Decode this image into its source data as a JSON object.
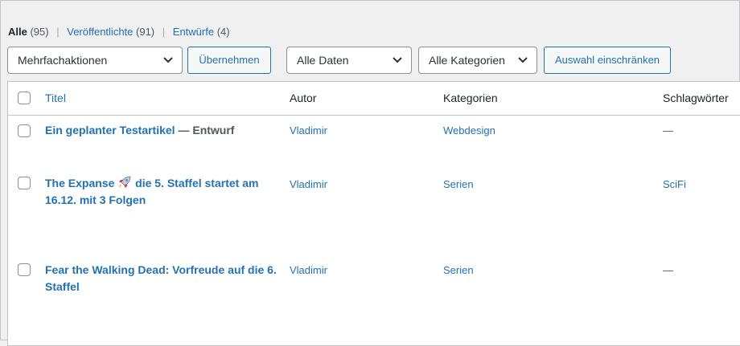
{
  "filters": {
    "all_label": "Alle",
    "all_count": "(95)",
    "published_label": "Veröffentlichte",
    "published_count": "(91)",
    "drafts_label": "Entwürfe",
    "drafts_count": "(4)",
    "separator": "|"
  },
  "toolbar": {
    "bulk_actions": "Mehrfachaktionen",
    "apply_button": "Übernehmen",
    "dates": "Alle Daten",
    "categories": "Alle Kategorien",
    "filter_button": "Auswahl einschränken"
  },
  "table": {
    "columns": {
      "title": "Titel",
      "author": "Autor",
      "categories": "Kategorien",
      "tags": "Schlagwörter"
    },
    "rows": [
      {
        "title": "Ein geplanter Testartikel",
        "state": "— Entwurf",
        "author": "Vladimir",
        "category": "Webdesign",
        "tags": "—"
      },
      {
        "title_part1": "The Expanse",
        "title_part2": "die 5. Staffel startet am 16.12. mit 3 Folgen",
        "title_icon": "rocket-icon",
        "author": "Vladimir",
        "category": "Serien",
        "tags": "SciFi"
      },
      {
        "title": "Fear the Walking Dead: Vorfreude auf die 6. Staffel",
        "author": "Vladimir",
        "category": "Serien",
        "tags": "—"
      }
    ]
  },
  "colors": {
    "link": "#2271b1",
    "background": "#f0f0f1",
    "border": "#c3c4c7"
  }
}
